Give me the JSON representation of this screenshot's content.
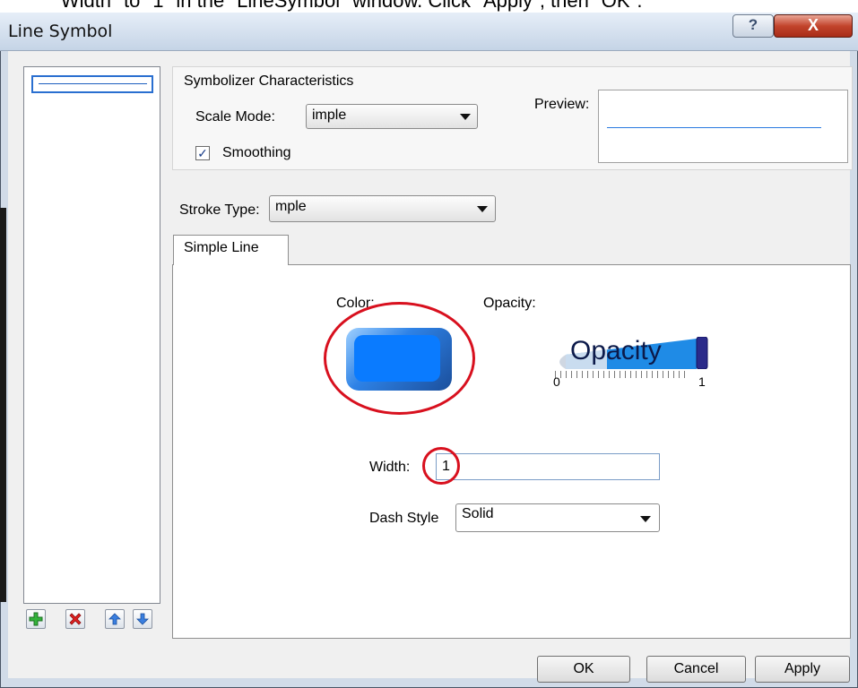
{
  "caption": {
    "text": "\"Width\" to \"1\" in the \"LineSymbol\" window. Click \"Apply\", then \"OK\"."
  },
  "window": {
    "title": "Line Symbol",
    "help_glyph": "?",
    "close_glyph": "X"
  },
  "symbolizer": {
    "group_label": "Symbolizer Characteristics",
    "scale_mode_label": "Scale Mode:",
    "scale_mode_value": "imple",
    "smoothing_label": "Smoothing",
    "smoothing_checked": true,
    "preview_label": "Preview:"
  },
  "stroke": {
    "label": "Stroke Type:",
    "value": "mple"
  },
  "tab": {
    "label": "Simple Line"
  },
  "simple_line": {
    "color_label": "Color:",
    "color_value": "#0a7bff",
    "opacity_label": "Opacity:",
    "opacity_text": "Opacity",
    "opacity_min": "0",
    "opacity_max": "1",
    "opacity_value": 1,
    "width_label": "Width:",
    "width_value": "1",
    "dash_label": "Dash Style",
    "dash_value": "Solid"
  },
  "toolbar": {
    "add_icon": "plus-icon",
    "remove_icon": "delete-icon",
    "up_icon": "arrow-up-icon",
    "down_icon": "arrow-down-icon"
  },
  "buttons": {
    "ok": "OK",
    "cancel": "Cancel",
    "apply": "Apply"
  },
  "annotations": {
    "highlight_color": "#d8101e"
  }
}
